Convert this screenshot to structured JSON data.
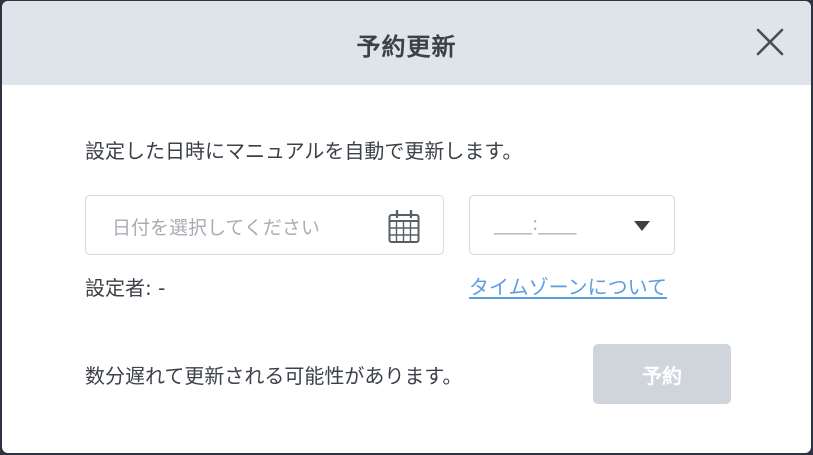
{
  "dialog": {
    "title": "予約更新",
    "close_icon": "close-icon",
    "description": "設定した日時にマニュアルを自動で更新します。",
    "date_input": {
      "placeholder": "日付を選択してください",
      "icon": "calendar-icon"
    },
    "time_select": {
      "value": "____:____",
      "icon": "caret-down-icon"
    },
    "setter_label": "設定者: -",
    "timezone_link": "タイムゾーンについて",
    "notice": "数分遅れて更新される可能性があります。",
    "reserve_button": "予約"
  },
  "colors": {
    "header_bg": "#dfe3ea",
    "link": "#5b9ee0",
    "button_disabled_bg": "#d0d4db",
    "text": "#3c4148",
    "placeholder": "#a9adb3"
  }
}
